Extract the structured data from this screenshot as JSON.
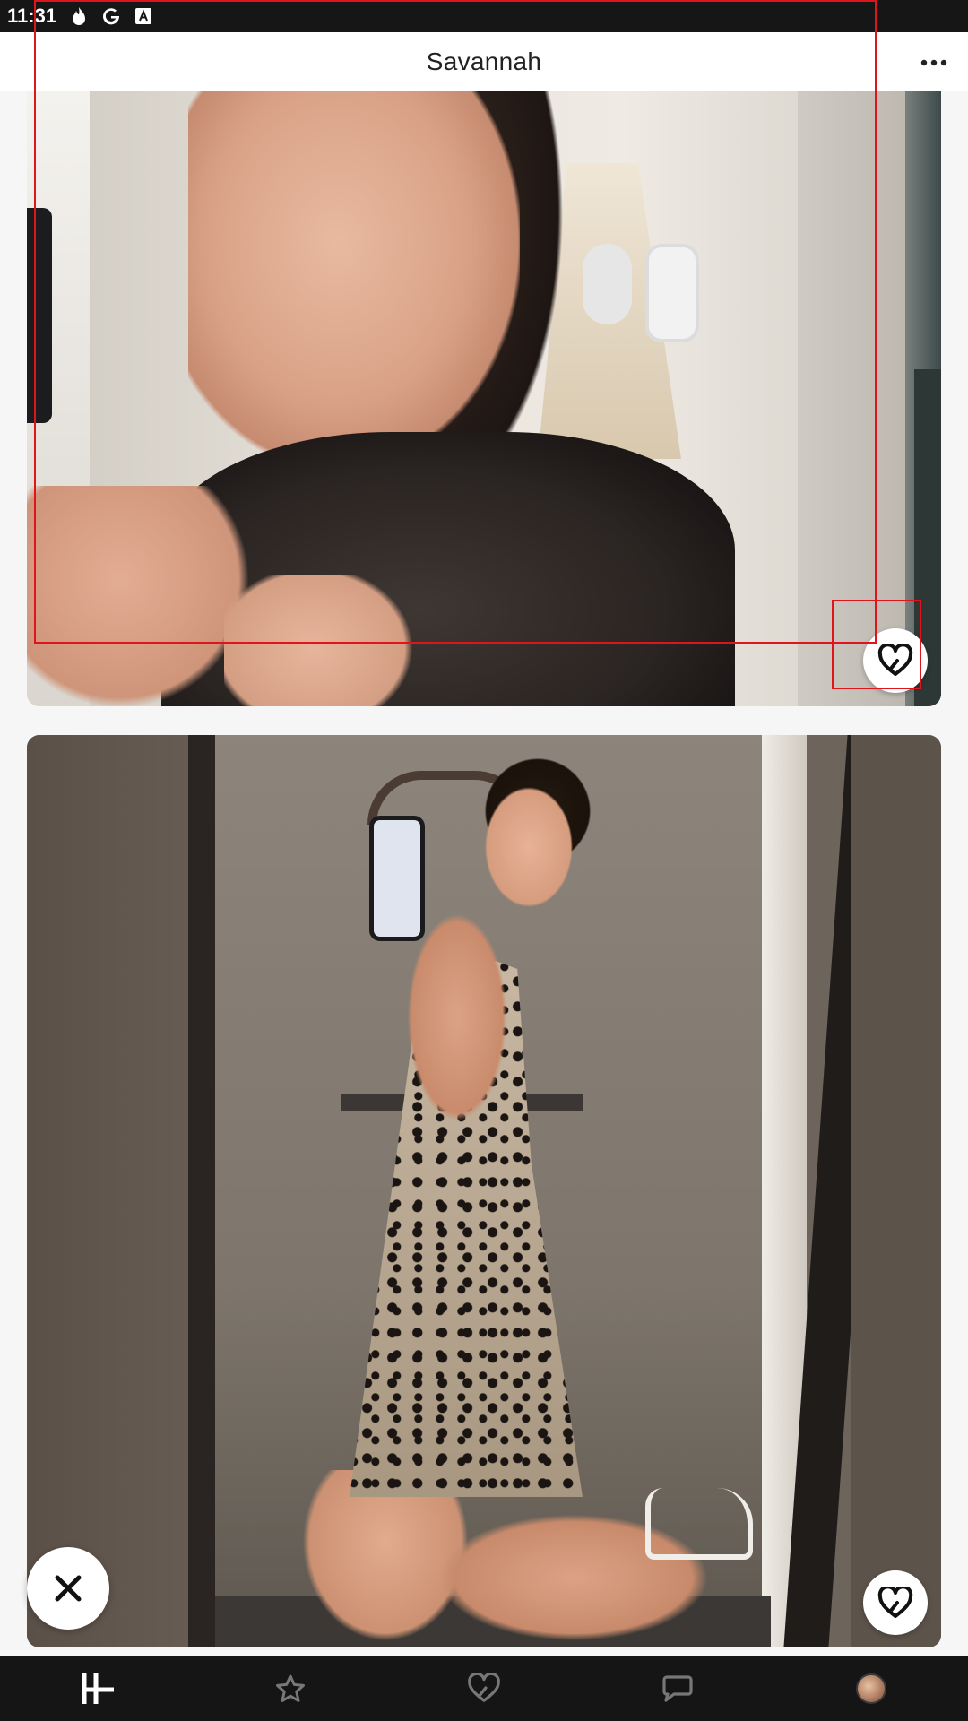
{
  "status_bar": {
    "time": "11:31",
    "icons": [
      "tinder-flame-icon",
      "google-icon",
      "font-icon"
    ]
  },
  "header": {
    "title": "Savannah",
    "more_icon": "more-horizontal-icon"
  },
  "photos": [
    {
      "like_icon": "heart-like-icon"
    },
    {
      "like_icon": "heart-like-icon"
    }
  ],
  "actions": {
    "skip_icon": "skip-x-icon"
  },
  "bottom_nav": {
    "items": [
      {
        "icon": "hinge-logo-icon",
        "active": true
      },
      {
        "icon": "star-icon",
        "active": false
      },
      {
        "icon": "heart-icon",
        "active": false
      },
      {
        "icon": "chat-icon",
        "active": false
      },
      {
        "icon": "profile-avatar",
        "active": false
      }
    ]
  },
  "colors": {
    "header_bg": "#ffffff",
    "nav_bg": "#151515",
    "status_bg": "#161616",
    "highlight_box": "#e0151c"
  }
}
